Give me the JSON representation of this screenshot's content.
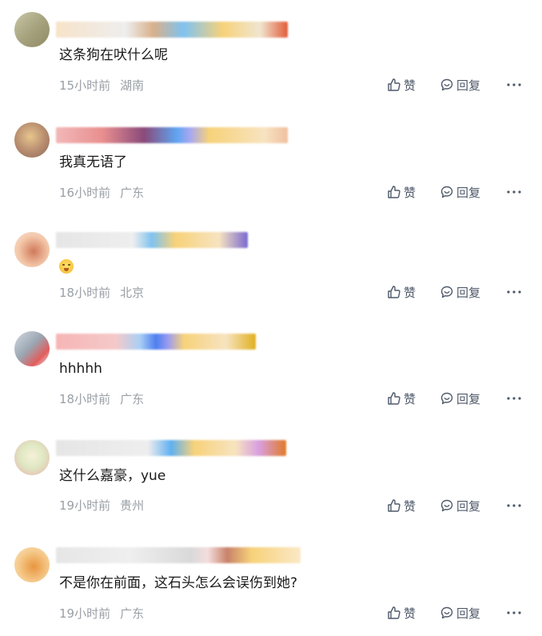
{
  "comments": [
    {
      "text": "这条狗在吠什么呢",
      "time": "15小时前",
      "location": "湖南",
      "like_label": "赞",
      "reply_label": "回复",
      "avatar_colors": [
        "#c9c7a8",
        "#8f8a63"
      ],
      "name_colors": [
        "#f7e3c9",
        "#7fc2f0",
        "#f7d27a",
        "#e25c3a"
      ]
    },
    {
      "text": "我真无语了",
      "time": "16小时前",
      "location": "广东",
      "like_label": "赞",
      "reply_label": "回复",
      "avatar_colors": [
        "#e7c58d",
        "#8d6a5a"
      ],
      "name_colors": [
        "#f2b8b8",
        "#8a4a7a",
        "#5fa4f0",
        "#f7d27a"
      ]
    },
    {
      "text": "",
      "emoji": "face-emoji",
      "time": "18小时前",
      "location": "北京",
      "like_label": "赞",
      "reply_label": "回复",
      "avatar_colors": [
        "#f3c6a8",
        "#d07a5a"
      ],
      "name_colors": [
        "#e6e6e6",
        "#7fc2f0",
        "#f7d27a",
        "#7a6ad0"
      ]
    },
    {
      "text": "hhhhh",
      "time": "18小时前",
      "location": "广东",
      "like_label": "赞",
      "reply_label": "回复",
      "avatar_colors": [
        "#b9c2cc",
        "#e25c5c"
      ],
      "name_colors": [
        "#f7b5b5",
        "#4d7ff0",
        "#f7d27a",
        "#e0b020"
      ]
    },
    {
      "text": "这什么嘉豪，yue",
      "time": "19小时前",
      "location": "贵州",
      "like_label": "赞",
      "reply_label": "回复",
      "avatar_colors": [
        "#dfe8c2",
        "#e9b0b0"
      ],
      "name_colors": [
        "#e6e6e6",
        "#5fb0f0",
        "#f7d27a",
        "#e07a2a"
      ]
    },
    {
      "text": "不是你在前面，这石头怎么会误伤到她?",
      "time": "19小时前",
      "location": "广东",
      "like_label": "赞",
      "reply_label": "回复",
      "avatar_colors": [
        "#f5c98a",
        "#e8963f"
      ],
      "name_colors": [
        "#e6e6e6",
        "#d9d9d9",
        "#c9826a",
        "#f7d27a"
      ]
    }
  ]
}
